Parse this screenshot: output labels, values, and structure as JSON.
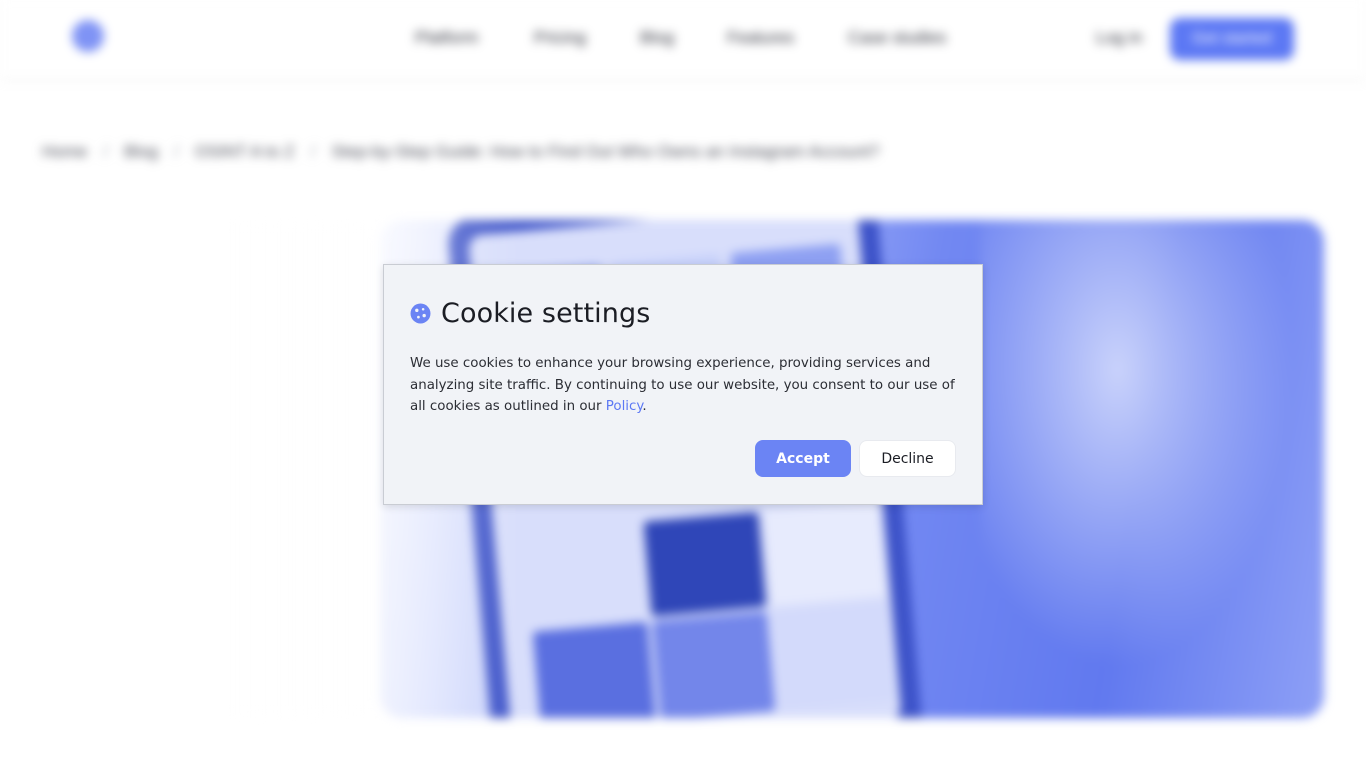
{
  "header": {
    "nav": [
      "Platform",
      "Pricing",
      "Blog",
      "Features",
      "Case studies"
    ],
    "login": "Log in",
    "cta": "Get started"
  },
  "breadcrumb": [
    "Home",
    "Blog",
    "OSINT A to Z",
    "Step-by-Step Guide: How to Find Out Who Owns an Instagram Account?"
  ],
  "cookie": {
    "title": "Cookie settings",
    "body": "We use cookies to enhance your browsing experience, providing services and analyzing site traffic. By continuing to use our website, you consent to our use of all cookies as outlined in our ",
    "link": "Policy",
    "body_end": ".",
    "accept": "Accept",
    "decline": "Decline"
  },
  "colors": {
    "accent": "#5c78f4",
    "dialog_bg": "#f1f3f7"
  }
}
